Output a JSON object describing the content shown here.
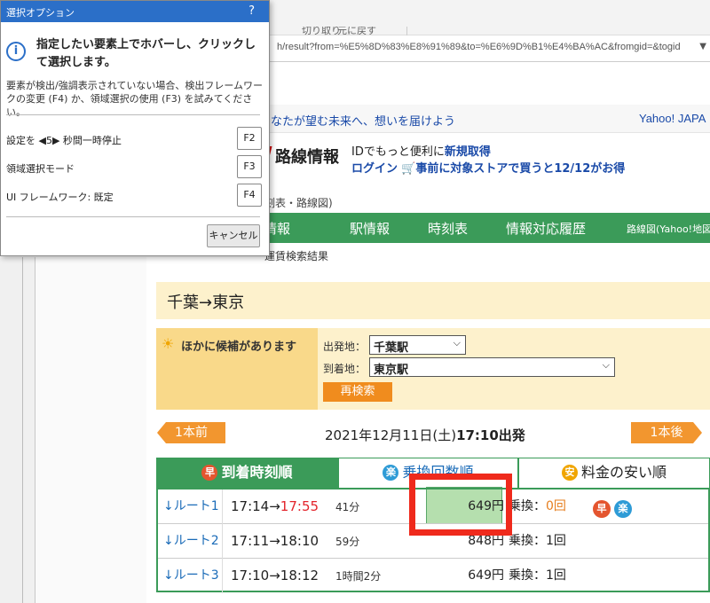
{
  "browser": {
    "toolbar_items": [
      "切り取り",
      "元に戻す"
    ],
    "url": "h/result?from=%E5%8D%83%E8%91%89&to=%E6%9D%B1%E4%BA%AC&fromgid=&togid"
  },
  "dialog": {
    "title": "選択オプション",
    "help": "?",
    "heading": "指定したい要素上でホバーし、クリックして選択します。",
    "description": "要素が検出/強調表示されていない場合、検出フレームワークの変更 (F4) か、領域選択の使用 (F3) を試みてください。",
    "options": [
      {
        "label": "設定を ◀5▶ 秒間一時停止",
        "key": "F2"
      },
      {
        "label": "領域選択モード",
        "key": "F3"
      },
      {
        "label": "UI フレームワーク: 既定",
        "key": "F4"
      }
    ],
    "cancel": "キャンセル"
  },
  "site": {
    "tagline": "なたが望む未来へ、想いを届けよう",
    "yahoo_link": "Yahoo! JAPA",
    "logo_text": "路線情報",
    "id_text": "IDでもっと便利に",
    "id_link": "新規取得",
    "login": "ログイン",
    "promo": "事前に対象ストアで買うと12/12がお得",
    "crumb_top": "刻表・路線図)",
    "nav": [
      "行情報",
      "駅情報",
      "時刻表",
      "情報対応履歴",
      "路線図(Yahoo!地図"
    ],
    "crumb_bottom": "運賃検索結果"
  },
  "search": {
    "heading": "千葉→東京",
    "candidates_label": "ほかに候補があります",
    "from_label": "出発地：",
    "from_value": "千葉駅",
    "to_label": "到着地：",
    "to_value": "東京駅",
    "research": "再検索",
    "prev": "1本前",
    "next": "1本後",
    "date_prefix": "2021年12月11日(土)",
    "date_time": "17:10出発"
  },
  "sort_tabs": [
    {
      "icon": "早",
      "label": "到着時刻順"
    },
    {
      "icon": "楽",
      "label": "乗換回数順"
    },
    {
      "icon": "安",
      "label": "料金の安い順"
    }
  ],
  "routes": [
    {
      "name": "↓ルート1",
      "dep": "17:14→",
      "arr": "17:55",
      "duration": "41分",
      "fare": "649円",
      "transfer_label": "乗換：",
      "transfers": "0回",
      "badges": [
        "早",
        "楽"
      ]
    },
    {
      "name": "↓ルート2",
      "dep": "17:11→",
      "arr": "18:10",
      "duration": "59分",
      "fare": "848円",
      "transfer_label": "乗換：",
      "transfers": "1回"
    },
    {
      "name": "↓ルート3",
      "dep": "17:10→",
      "arr": "18:12",
      "duration": "1時間2分",
      "fare": "649円",
      "transfer_label": "乗換：",
      "transfers": "1回"
    }
  ],
  "colors": {
    "accent_green": "#3b9b59",
    "highlight_red": "#ef2a1c",
    "dialog_blue": "#2b6fc8"
  }
}
